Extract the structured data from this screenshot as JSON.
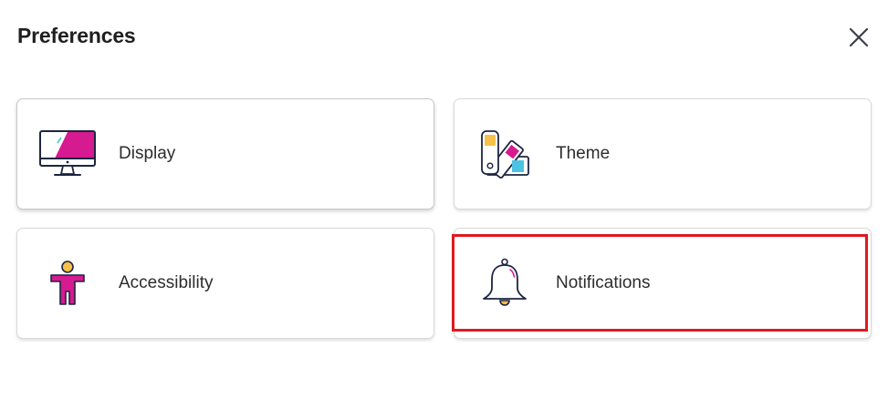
{
  "dialog": {
    "title": "Preferences",
    "close_icon": "close-icon"
  },
  "cards": [
    {
      "label": "Display",
      "icon": "monitor-icon"
    },
    {
      "label": "Theme",
      "icon": "color-palette-icon"
    },
    {
      "label": "Accessibility",
      "icon": "accessibility-person-icon"
    },
    {
      "label": "Notifications",
      "icon": "bell-icon"
    }
  ],
  "colors": {
    "accent_magenta": "#d61a8f",
    "accent_yellow": "#f7c04a",
    "accent_cyan": "#4cc3e0",
    "outline_navy": "#1c2541",
    "highlight_red": "#e0191f"
  }
}
